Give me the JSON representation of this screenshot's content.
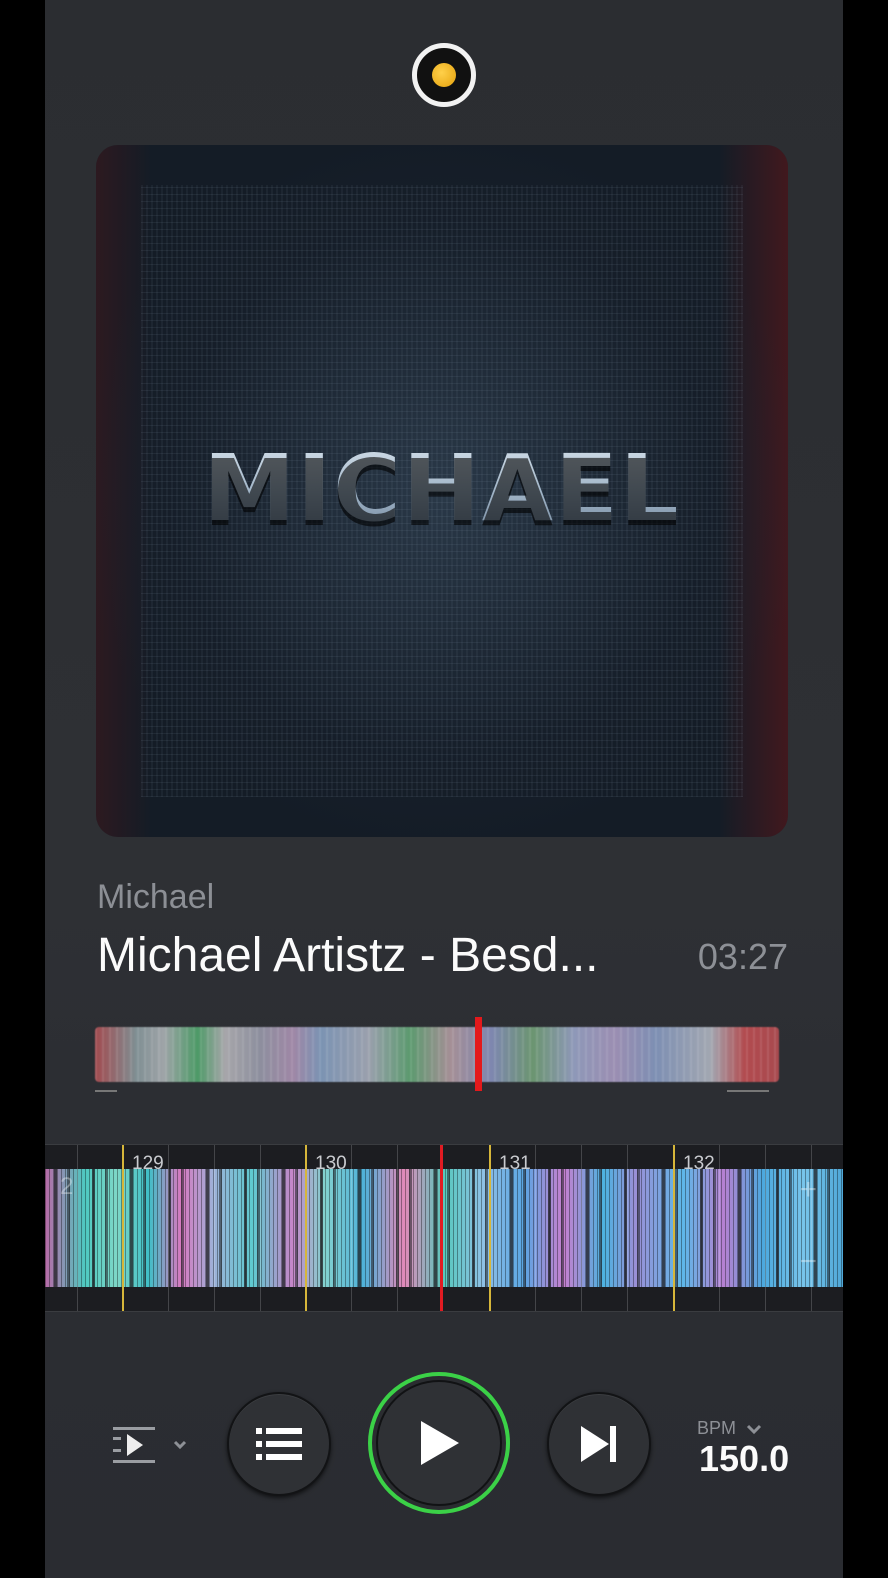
{
  "album_art": {
    "title_text": "MICHAEL"
  },
  "now_playing": {
    "artist": "Michael",
    "track_title": "Michael Artistz - Besd...",
    "duration": "03:27"
  },
  "overview": {
    "playhead_position": 0.56
  },
  "waveform": {
    "bar_numbers": [
      "129",
      "130",
      "131",
      "132"
    ],
    "left_marker": "2",
    "zoom_in": "+",
    "zoom_out": "−"
  },
  "controls": {
    "bpm_label": "BPM",
    "bpm_value": "150.0",
    "play_state": "paused"
  },
  "colors": {
    "accent": "#3bd147",
    "playhead": "#e11b22",
    "beat_marker": "#d6b63a"
  },
  "icons": {
    "handle": "record-indicator-icon",
    "mode": "play-mode-icon",
    "queue": "queue-list-icon",
    "play": "play-icon",
    "next": "skip-next-icon"
  }
}
